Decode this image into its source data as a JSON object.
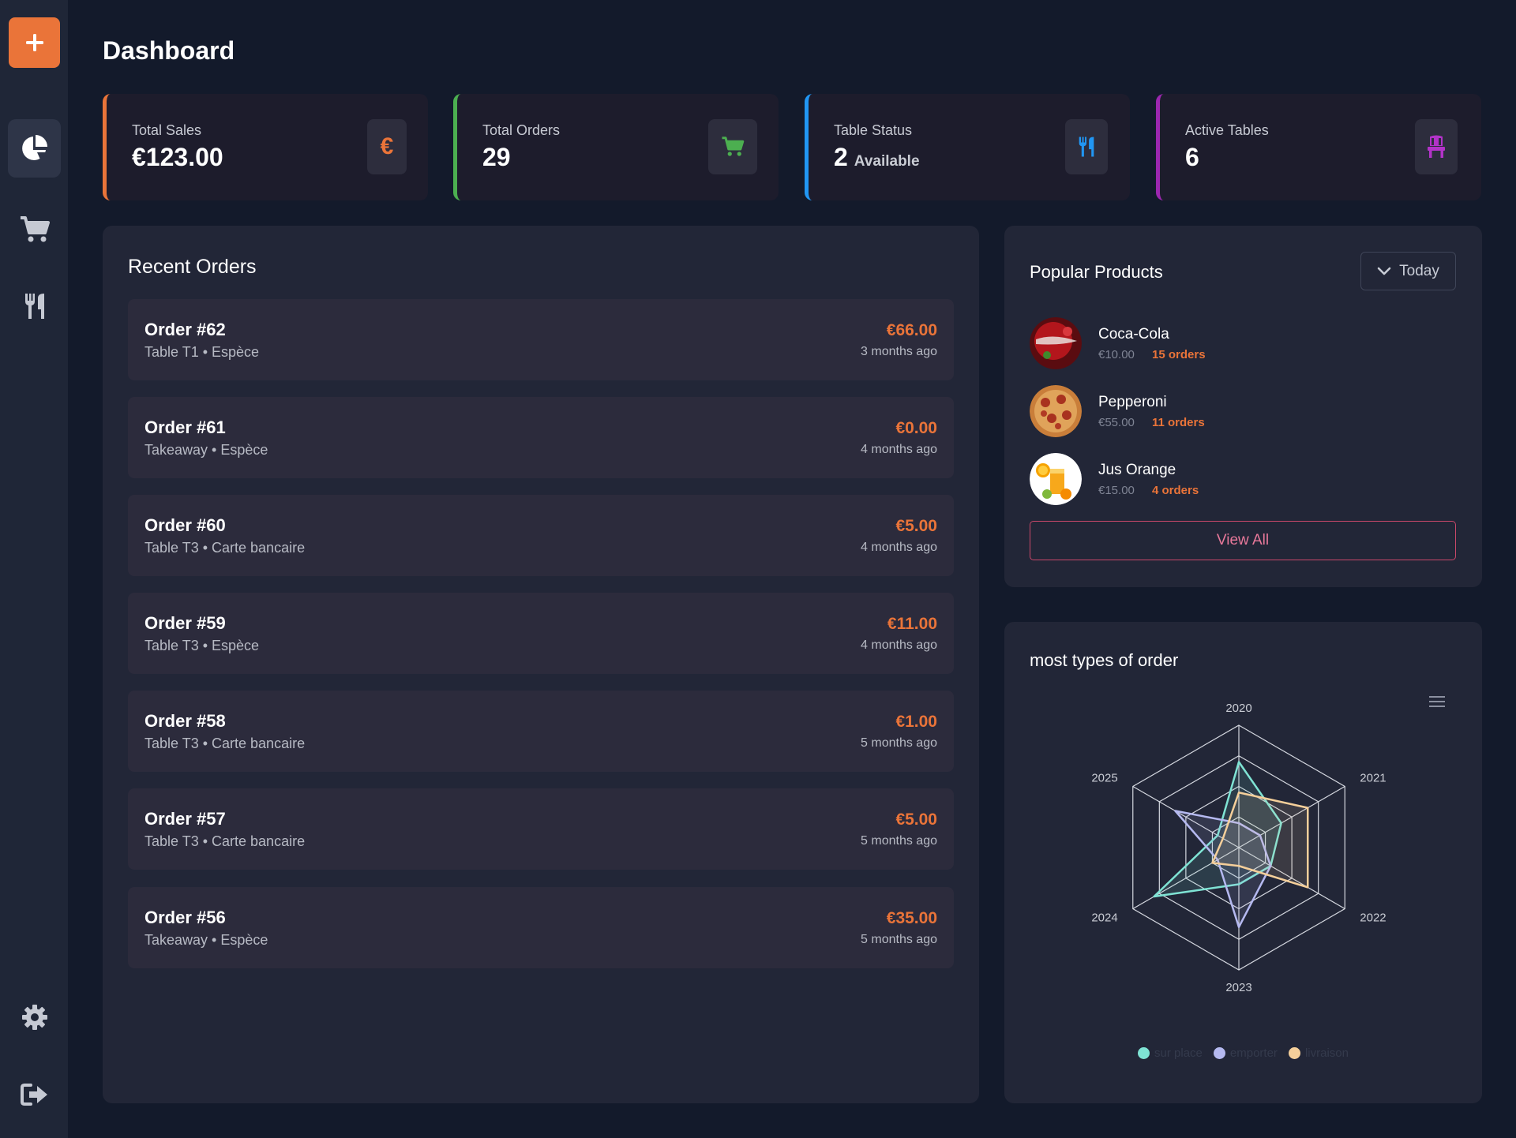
{
  "page": {
    "title": "Dashboard"
  },
  "sidebar": {
    "items": [
      {
        "name": "add",
        "icon": "plus-icon"
      },
      {
        "name": "dashboard",
        "icon": "pie-chart-icon",
        "active": true
      },
      {
        "name": "orders",
        "icon": "shopping-cart-icon"
      },
      {
        "name": "menu",
        "icon": "utensils-icon"
      },
      {
        "name": "settings",
        "icon": "gear-icon"
      },
      {
        "name": "logout",
        "icon": "sign-out-icon"
      }
    ]
  },
  "stats": [
    {
      "label": "Total Sales",
      "value": "€123.00",
      "suffix": "",
      "icon": "euro-icon",
      "color": "#ea7439"
    },
    {
      "label": "Total Orders",
      "value": "29",
      "suffix": "",
      "icon": "shopping-cart-icon",
      "color": "#4caf50"
    },
    {
      "label": "Table Status",
      "value": "2",
      "suffix": "Available",
      "icon": "utensils-icon",
      "color": "#2196f3"
    },
    {
      "label": "Active Tables",
      "value": "6",
      "suffix": "",
      "icon": "chair-icon",
      "color": "#9c27b0"
    }
  ],
  "recent_orders": {
    "title": "Recent Orders",
    "items": [
      {
        "title": "Order #62",
        "subtitle": "Table T1 • Espèce",
        "amount": "€66.00",
        "time": "3 months ago"
      },
      {
        "title": "Order #61",
        "subtitle": "Takeaway • Espèce",
        "amount": "€0.00",
        "time": "4 months ago"
      },
      {
        "title": "Order #60",
        "subtitle": "Table T3 • Carte bancaire",
        "amount": "€5.00",
        "time": "4 months ago"
      },
      {
        "title": "Order #59",
        "subtitle": "Table T3 • Espèce",
        "amount": "€11.00",
        "time": "4 months ago"
      },
      {
        "title": "Order #58",
        "subtitle": "Table T3 • Carte bancaire",
        "amount": "€1.00",
        "time": "5 months ago"
      },
      {
        "title": "Order #57",
        "subtitle": "Table T3 • Carte bancaire",
        "amount": "€5.00",
        "time": "5 months ago"
      },
      {
        "title": "Order #56",
        "subtitle": "Takeaway • Espèce",
        "amount": "€35.00",
        "time": "5 months ago"
      }
    ]
  },
  "popular_products": {
    "title": "Popular Products",
    "filter": "Today",
    "view_all": "View All",
    "items": [
      {
        "name": "Coca-Cola",
        "price": "€10.00",
        "orders": "15 orders",
        "image": "coca-cola-image"
      },
      {
        "name": "Pepperoni",
        "price": "€55.00",
        "orders": "11 orders",
        "image": "pizza-image"
      },
      {
        "name": "Jus Orange",
        "price": "€15.00",
        "orders": "4 orders",
        "image": "orange-juice-image"
      }
    ]
  },
  "order_types_chart": {
    "title": "most types of order",
    "menu_icon": "hamburger-menu-icon"
  },
  "chart_data": {
    "type": "radar",
    "title": "most types of order",
    "categories": [
      "2020",
      "2021",
      "2022",
      "2023",
      "2024",
      "2025"
    ],
    "max": 100,
    "series": [
      {
        "name": "sur place",
        "color": "#7fe3d4",
        "values": [
          70,
          40,
          30,
          30,
          80,
          20
        ]
      },
      {
        "name": "emporter",
        "color": "#b5b9f0",
        "values": [
          20,
          20,
          30,
          65,
          20,
          60
        ]
      },
      {
        "name": "livraison",
        "color": "#f5cf9a",
        "values": [
          45,
          65,
          65,
          15,
          25,
          15
        ]
      }
    ],
    "legend_position": "bottom"
  }
}
